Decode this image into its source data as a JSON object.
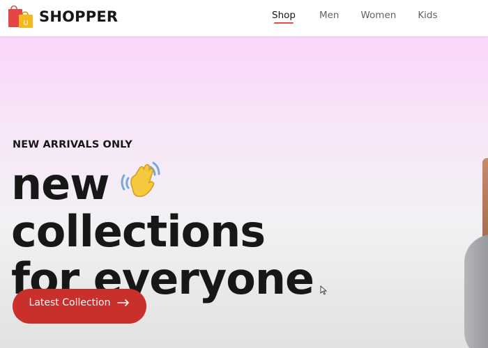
{
  "brand": {
    "name": "SHOPPER",
    "logo_letter": "U"
  },
  "nav": {
    "items": [
      {
        "label": "Shop",
        "active": true
      },
      {
        "label": "Men",
        "active": false
      },
      {
        "label": "Women",
        "active": false
      },
      {
        "label": "Kids",
        "active": false
      }
    ]
  },
  "hero": {
    "tagline": "NEW ARRIVALS ONLY",
    "headline": [
      "new",
      "collections",
      "for everyone"
    ],
    "cta_label": "Latest Collection"
  },
  "colors": {
    "accent": "#c9302b",
    "nav_underline": "#e74c4c",
    "text": "#171717",
    "hero_gradient_top": "#fad6fa",
    "hero_gradient_bottom": "#e2e2e2"
  },
  "icons": [
    "shopping-bag-icon",
    "waving-hand-icon",
    "arrow-right-icon",
    "mouse-pointer-icon"
  ]
}
